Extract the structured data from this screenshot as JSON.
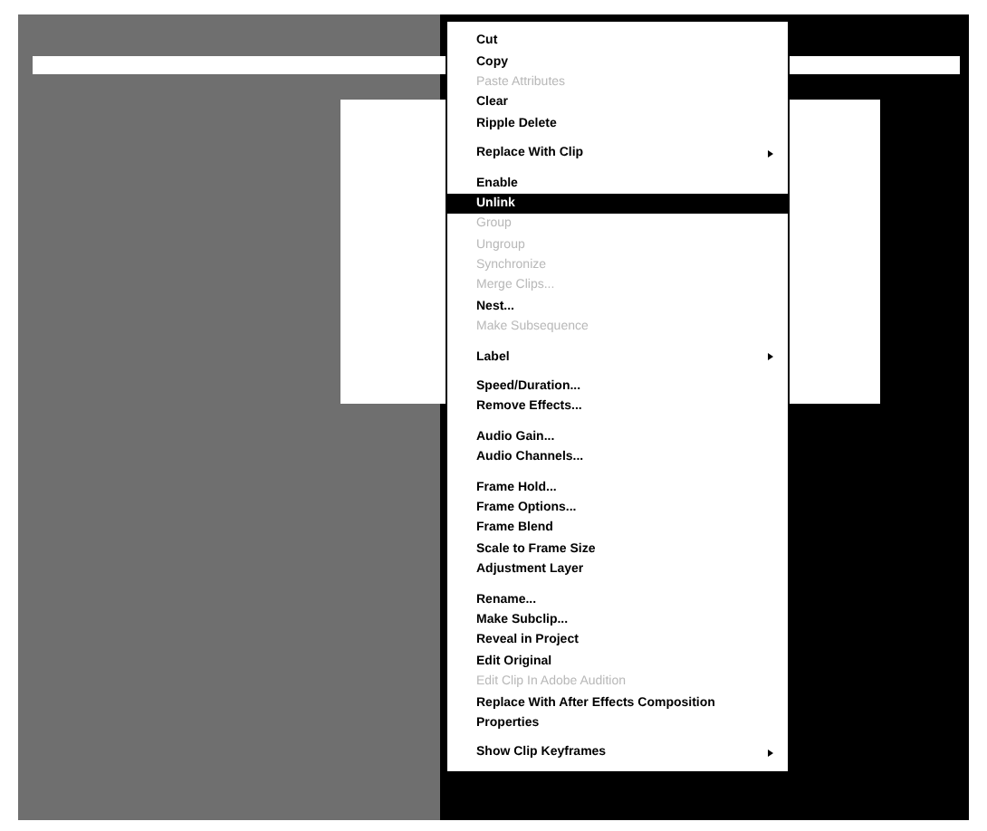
{
  "context_menu": {
    "items": [
      {
        "kind": "item",
        "label": "Cut",
        "disabled": false,
        "selected": false,
        "submenu": false
      },
      {
        "kind": "item",
        "label": "Copy",
        "disabled": false,
        "selected": false,
        "submenu": false
      },
      {
        "kind": "item",
        "label": "Paste Attributes",
        "disabled": true,
        "selected": false,
        "submenu": false
      },
      {
        "kind": "item",
        "label": "Clear",
        "disabled": false,
        "selected": false,
        "submenu": false
      },
      {
        "kind": "item",
        "label": "Ripple Delete",
        "disabled": false,
        "selected": false,
        "submenu": false
      },
      {
        "kind": "separator"
      },
      {
        "kind": "item",
        "label": "Replace With Clip",
        "disabled": false,
        "selected": false,
        "submenu": true
      },
      {
        "kind": "separator"
      },
      {
        "kind": "item",
        "label": "Enable",
        "disabled": false,
        "selected": false,
        "submenu": false
      },
      {
        "kind": "item",
        "label": "Unlink",
        "disabled": false,
        "selected": true,
        "submenu": false
      },
      {
        "kind": "item",
        "label": "Group",
        "disabled": true,
        "selected": false,
        "submenu": false
      },
      {
        "kind": "item",
        "label": "Ungroup",
        "disabled": true,
        "selected": false,
        "submenu": false
      },
      {
        "kind": "item",
        "label": "Synchronize",
        "disabled": true,
        "selected": false,
        "submenu": false
      },
      {
        "kind": "item",
        "label": "Merge Clips...",
        "disabled": true,
        "selected": false,
        "submenu": false
      },
      {
        "kind": "item",
        "label": "Nest...",
        "disabled": false,
        "selected": false,
        "submenu": false
      },
      {
        "kind": "item",
        "label": "Make Subsequence",
        "disabled": true,
        "selected": false,
        "submenu": false
      },
      {
        "kind": "separator"
      },
      {
        "kind": "item",
        "label": "Label",
        "disabled": false,
        "selected": false,
        "submenu": true
      },
      {
        "kind": "separator"
      },
      {
        "kind": "item",
        "label": "Speed/Duration...",
        "disabled": false,
        "selected": false,
        "submenu": false
      },
      {
        "kind": "item",
        "label": "Remove Effects...",
        "disabled": false,
        "selected": false,
        "submenu": false
      },
      {
        "kind": "separator"
      },
      {
        "kind": "item",
        "label": "Audio Gain...",
        "disabled": false,
        "selected": false,
        "submenu": false
      },
      {
        "kind": "item",
        "label": "Audio Channels...",
        "disabled": false,
        "selected": false,
        "submenu": false
      },
      {
        "kind": "separator"
      },
      {
        "kind": "item",
        "label": "Frame Hold...",
        "disabled": false,
        "selected": false,
        "submenu": false
      },
      {
        "kind": "item",
        "label": "Frame Options...",
        "disabled": false,
        "selected": false,
        "submenu": false
      },
      {
        "kind": "item",
        "label": "Frame Blend",
        "disabled": false,
        "selected": false,
        "submenu": false
      },
      {
        "kind": "item",
        "label": "Scale to Frame Size",
        "disabled": false,
        "selected": false,
        "submenu": false
      },
      {
        "kind": "item",
        "label": "Adjustment Layer",
        "disabled": false,
        "selected": false,
        "submenu": false
      },
      {
        "kind": "separator"
      },
      {
        "kind": "item",
        "label": "Rename...",
        "disabled": false,
        "selected": false,
        "submenu": false
      },
      {
        "kind": "item",
        "label": "Make Subclip...",
        "disabled": false,
        "selected": false,
        "submenu": false
      },
      {
        "kind": "item",
        "label": "Reveal in Project",
        "disabled": false,
        "selected": false,
        "submenu": false
      },
      {
        "kind": "item",
        "label": "Edit Original",
        "disabled": false,
        "selected": false,
        "submenu": false
      },
      {
        "kind": "item",
        "label": "Edit Clip In Adobe Audition",
        "disabled": true,
        "selected": false,
        "submenu": false
      },
      {
        "kind": "item",
        "label": "Replace With After Effects Composition",
        "disabled": false,
        "selected": false,
        "submenu": false
      },
      {
        "kind": "item",
        "label": "Properties",
        "disabled": false,
        "selected": false,
        "submenu": false
      },
      {
        "kind": "separator"
      },
      {
        "kind": "item",
        "label": "Show Clip Keyframes",
        "disabled": false,
        "selected": false,
        "submenu": true
      }
    ]
  }
}
